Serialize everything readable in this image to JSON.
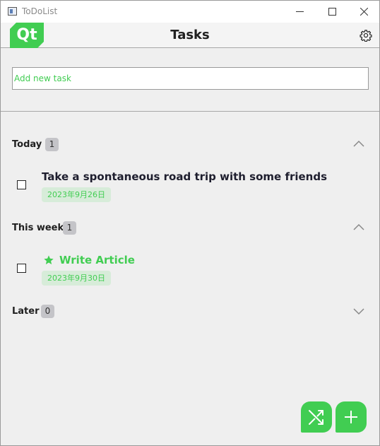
{
  "window": {
    "title": "ToDoList"
  },
  "header": {
    "logo_text": "Qt",
    "title": "Tasks"
  },
  "new_task": {
    "placeholder": "Add new task",
    "value": ""
  },
  "sections": [
    {
      "title": "Today",
      "count": "1",
      "expanded": true,
      "tasks": [
        {
          "title": "Take a spontaneous road trip with some friends",
          "date": "2023年9月26日",
          "starred": false,
          "done": false
        }
      ]
    },
    {
      "title": "This week",
      "count": "1",
      "expanded": true,
      "tasks": [
        {
          "title": "Write Article",
          "date": "2023年9月30日",
          "starred": true,
          "done": false
        }
      ]
    },
    {
      "title": "Later",
      "count": "0",
      "expanded": false,
      "tasks": []
    }
  ],
  "colors": {
    "accent": "#41cd52",
    "badge": "#c4c4c8",
    "date_chip": "#d7ecd9",
    "background": "#efefef"
  },
  "icons": {
    "settings": "gear-icon",
    "shuffle": "shuffle-icon",
    "add": "plus-icon",
    "collapse": "chevron-up-icon",
    "expand": "chevron-down-icon",
    "star": "star-icon"
  }
}
